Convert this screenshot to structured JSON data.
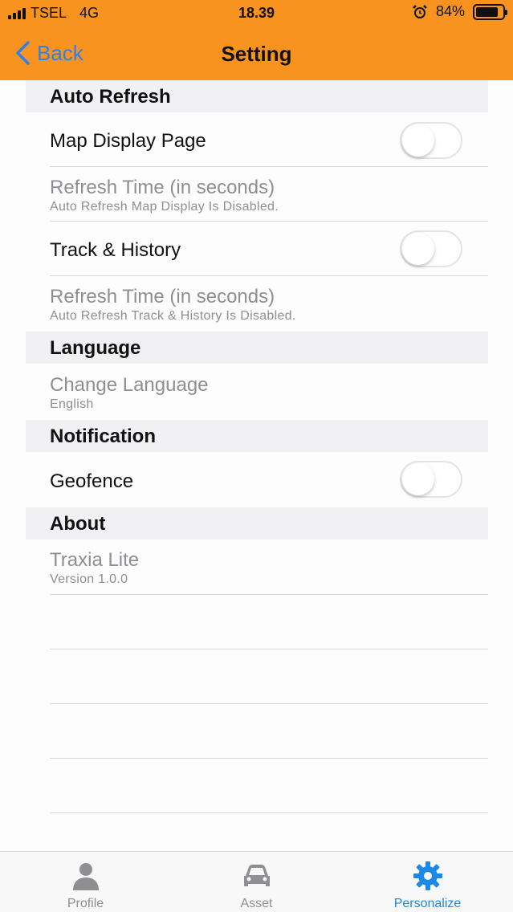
{
  "status": {
    "carrier": "TSEL",
    "network": "4G",
    "time": "18.39",
    "battery_text": "84%",
    "battery_level": 0.84,
    "icons": [
      "signal-icon",
      "alarm-icon",
      "battery-icon"
    ]
  },
  "nav": {
    "back_label": "Back",
    "title": "Setting"
  },
  "sections": {
    "auto_refresh": {
      "header": "Auto Refresh",
      "map_display": {
        "label": "Map Display Page",
        "toggle_on": false
      },
      "map_refresh": {
        "title": "Refresh Time (in seconds)",
        "subtitle": "Auto Refresh Map Display Is Disabled."
      },
      "track_history": {
        "label": "Track & History",
        "toggle_on": false
      },
      "track_refresh": {
        "title": "Refresh Time (in seconds)",
        "subtitle": "Auto Refresh Track & History Is Disabled."
      }
    },
    "language": {
      "header": "Language",
      "change": {
        "title": "Change Language",
        "subtitle": "English"
      }
    },
    "notification": {
      "header": "Notification",
      "geofence": {
        "label": "Geofence",
        "toggle_on": false
      }
    },
    "about": {
      "header": "About",
      "app": {
        "title": "Traxia Lite",
        "subtitle": "Version 1.0.0"
      }
    }
  },
  "tabs": [
    {
      "label": "Profile",
      "icon": "person-icon",
      "active": false
    },
    {
      "label": "Asset",
      "icon": "car-icon",
      "active": false
    },
    {
      "label": "Personalize",
      "icon": "gear-icon",
      "active": true
    }
  ],
  "colors": {
    "accent": "#f7931e",
    "link": "#2f80ed",
    "active_tab": "#1e88e5",
    "inactive_tab": "#8e8e93"
  }
}
